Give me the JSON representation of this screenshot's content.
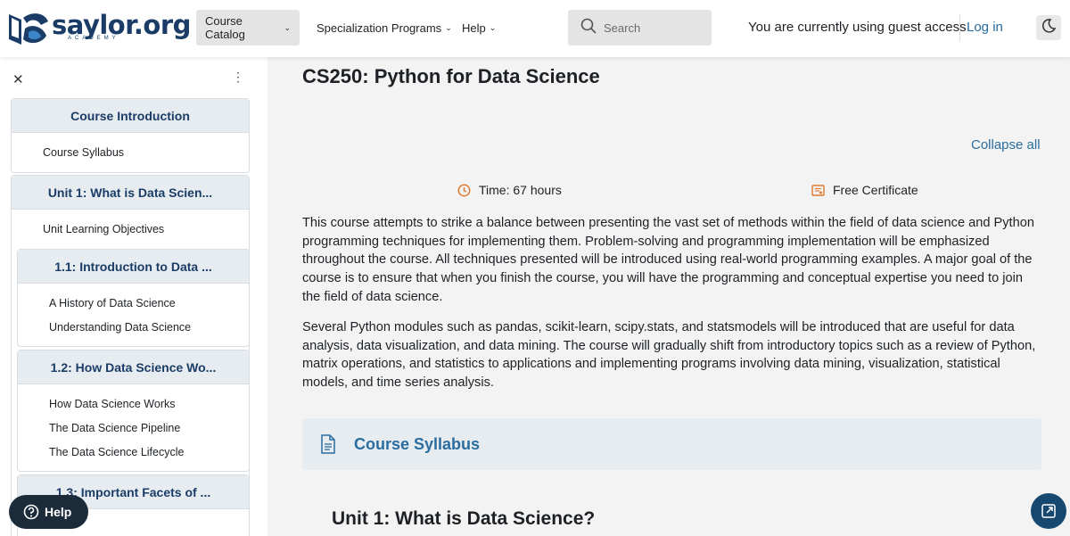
{
  "header": {
    "logo_text": "saylor.org",
    "logo_sub": "ACADEMY",
    "nav": [
      {
        "label": "Course Catalog"
      },
      {
        "label": "Specialization Programs"
      },
      {
        "label": "Help"
      }
    ],
    "search_placeholder": "Search",
    "guest_text": "You are currently using guest access",
    "login_label": "Log in"
  },
  "sidebar": {
    "sections": [
      {
        "title": "Course Introduction",
        "links": [
          "Course Syllabus"
        ]
      },
      {
        "title": "Unit 1: What is Data Scien...",
        "links": [
          "Unit Learning Objectives"
        ]
      },
      {
        "title": "1.1: Introduction to Data ...",
        "links": [
          "A History of Data Science",
          "Understanding Data Science"
        ]
      },
      {
        "title": "1.2: How Data Science Wo...",
        "links": [
          "How Data Science Works",
          "The Data Science Pipeline",
          "The Data Science Lifecycle"
        ]
      },
      {
        "title": "1.3: Important Facets of ...",
        "links": []
      }
    ]
  },
  "main": {
    "title": "CS250: Python for Data Science",
    "collapse_all": "Collapse all",
    "time": "Time: 67 hours",
    "certificate": "Free Certificate",
    "paragraph1": "This course attempts to strike a balance between presenting the vast set of methods within the field of data science and Python programming techniques for implementing them. Problem-solving and programming implementation will be emphasized throughout the course. All techniques presented will be introduced using real-world programming examples. A major goal of the course is to ensure that when you finish the course, you will have the programming and conceptual expertise you need to join the field of data science.",
    "paragraph2": "Several Python modules such as pandas, scikit-learn, scipy.stats, and statsmodels will be introduced that are useful for data analysis, data visualization, and data mining. The course will gradually shift from introductory topics such as a review of Python, matrix operations, and statistics to applications and implementing programs involving data mining, visualization, statistical models, and time series analysis.",
    "syllabus_label": "Course Syllabus",
    "unit_title": "Unit 1: What is Data Science?"
  },
  "help_button": "Help",
  "colors": {
    "brand": "#1b3c66",
    "link": "#2a6d9e",
    "accent_orange": "#e07a2e"
  }
}
